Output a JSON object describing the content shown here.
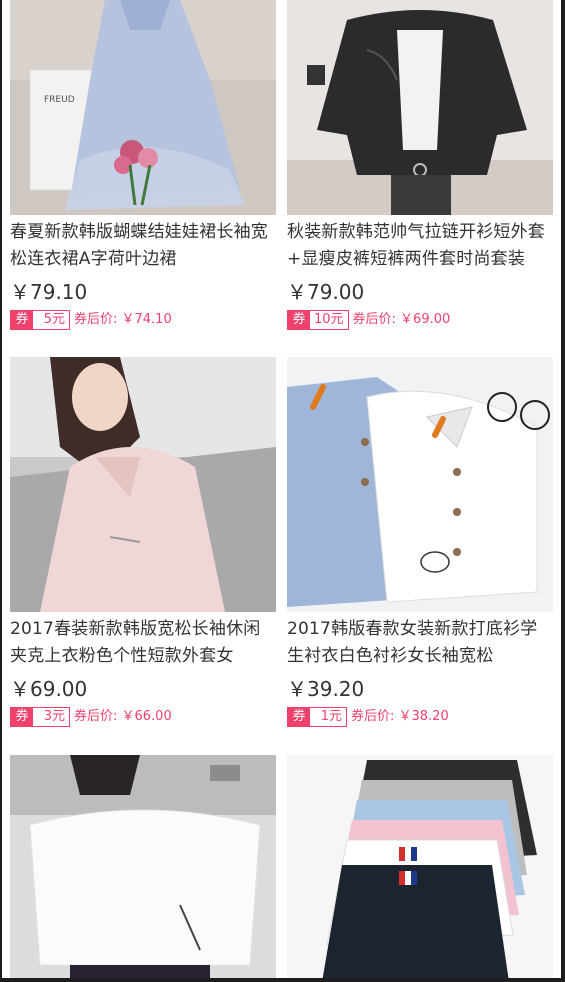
{
  "colors": {
    "accent": "#f0416c",
    "text": "#333333"
  },
  "products": [
    {
      "title": "春夏新款韩版蝴蝶结娃娃裙长袖宽松连衣裙A字荷叶边裙",
      "price": "￥79.10",
      "coupon_tag": "券",
      "coupon_value": "5元",
      "after_price": "券后价: ￥74.10",
      "image_text": "FREUD"
    },
    {
      "title": "秋装新款韩范帅气拉链开衫短外套+显瘦皮裤短裤两件套时尚套装",
      "price": "￥79.00",
      "coupon_tag": "券",
      "coupon_value": "10元",
      "after_price": "券后价: ￥69.00"
    },
    {
      "title": "2017春装新款韩版宽松长袖休闲夹克上衣粉色个性短款外套女",
      "price": "￥69.00",
      "coupon_tag": "券",
      "coupon_value": "3元",
      "after_price": "券后价: ￥66.00"
    },
    {
      "title": "2017韩版春款女装新款打底衫学生衬衣白色衬衫女长袖宽松",
      "price": "￥39.20",
      "coupon_tag": "券",
      "coupon_value": "1元",
      "after_price": "券后价: ￥38.20"
    },
    {
      "title": "",
      "price": "",
      "coupon_tag": "",
      "coupon_value": "",
      "after_price": ""
    },
    {
      "title": "",
      "price": "",
      "coupon_tag": "",
      "coupon_value": "",
      "after_price": ""
    }
  ]
}
